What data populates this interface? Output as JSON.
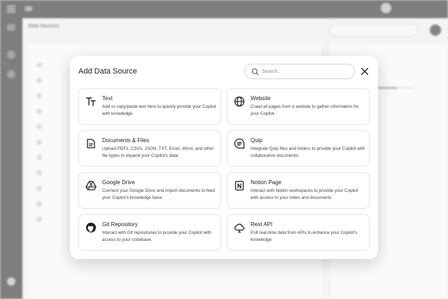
{
  "modal": {
    "title": "Add Data Source",
    "search_placeholder": "Search..",
    "sources": [
      {
        "title": "Text",
        "icon": "text-format-icon",
        "desc": "Add or copy/paste text here to quickly provide your Copilot with knowledge."
      },
      {
        "title": "Website",
        "icon": "globe-icon",
        "desc": "Crawl all pages from a website to gather information for your Copilot."
      },
      {
        "title": "Documents & Files",
        "icon": "document-icon",
        "desc": "Upload PDFs, CSVs, JSON, TXT, Excel, Word, and other file types to expand your Copilot's data."
      },
      {
        "title": "Quip",
        "icon": "quip-icon",
        "desc": "Integrate Quip files and folders to provide your Copilot with collaborative documents."
      },
      {
        "title": "Google Drive",
        "icon": "google-drive-icon",
        "desc": "Connect your Google Drive and import documents to feed your Copilot's knowledge base."
      },
      {
        "title": "Notion Page",
        "icon": "notion-icon",
        "desc": "Interact with Notion workspaces to provide your Copilot with access to your notes and documents"
      },
      {
        "title": "Git Repository",
        "icon": "github-icon",
        "desc": "Interact with Git repositories to provide your Copilot with access to your codebase."
      },
      {
        "title": "Rest API",
        "icon": "cloud-api-icon",
        "desc": "Pull real-time data from APIs to enhance your Copilot's knowledge"
      }
    ]
  },
  "background": {
    "page_title": "Data Sources",
    "colors": {
      "topbar": "#3a3a3a",
      "modal": "#ffffff"
    }
  }
}
